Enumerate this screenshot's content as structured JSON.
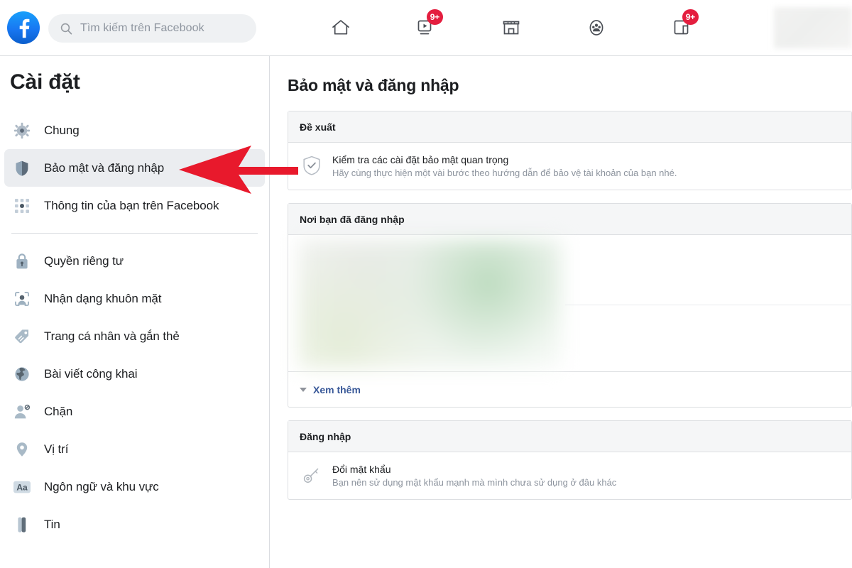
{
  "topbar": {
    "logo_name": "facebook-logo",
    "search": {
      "placeholder": "Tìm kiếm trên Facebook",
      "value": "",
      "icon": "search-icon"
    },
    "nav_items": [
      {
        "name": "home",
        "icon": "home-icon",
        "badge": ""
      },
      {
        "name": "watch",
        "icon": "video-icon",
        "badge": "9+"
      },
      {
        "name": "marketplace",
        "icon": "shop-icon",
        "badge": ""
      },
      {
        "name": "groups",
        "icon": "groups-icon",
        "badge": ""
      },
      {
        "name": "gaming",
        "icon": "gaming-icon",
        "badge": "9+"
      }
    ],
    "profile": {
      "name": "profile-area",
      "label": ""
    }
  },
  "sidebar": {
    "title": "Cài đặt",
    "group_one": [
      {
        "label": "Chung",
        "icon": "gear-icon",
        "active": false
      },
      {
        "label": "Bảo mật và đăng nhập",
        "icon": "shield-icon",
        "active": true
      },
      {
        "label": "Thông tin của bạn trên Facebook",
        "icon": "grid-dots-icon",
        "active": false
      }
    ],
    "group_two": [
      {
        "label": "Quyền riêng tư",
        "icon": "lock-icon",
        "active": false
      },
      {
        "label": "Nhận dạng khuôn mặt",
        "icon": "face-recognition-icon",
        "active": false
      },
      {
        "label": "Trang cá nhân và gắn thẻ",
        "icon": "tag-icon",
        "active": false
      },
      {
        "label": "Bài viết công khai",
        "icon": "globe-icon",
        "active": false
      },
      {
        "label": "Chặn",
        "icon": "block-user-icon",
        "active": false
      },
      {
        "label": "Vị trí",
        "icon": "location-pin-icon",
        "active": false
      },
      {
        "label": "Ngôn ngữ và khu vực",
        "icon": "language-aa-icon",
        "active": false
      },
      {
        "label": "Tin",
        "icon": "stories-icon",
        "active": false
      }
    ]
  },
  "main": {
    "page_title": "Bảo mật và đăng nhập",
    "cards": {
      "suggestions": {
        "header": "Đề xuất",
        "row": {
          "icon": "shield-check-icon",
          "title": "Kiểm tra các cài đặt bảo mật quan trọng",
          "subtitle": "Hãy cùng thực hiện một vài bước theo hướng dẫn để bảo vệ tài khoản của bạn nhé."
        }
      },
      "where_logged_in": {
        "header": "Nơi bạn đã đăng nhập",
        "footer_link": "Xem thêm",
        "footer_caret": "chevron-down-icon"
      },
      "login": {
        "header": "Đăng nhập",
        "row": {
          "icon": "key-icon",
          "title": "Đổi mật khẩu",
          "subtitle": "Bạn nên sử dụng mật khẩu mạnh mà mình chưa sử dụng ở đâu khác"
        }
      }
    }
  },
  "annotation": {
    "name": "red-arrow-pointing-to-security-login",
    "color": "#e8192c"
  },
  "colors": {
    "facebook_blue": "#1877f2",
    "badge_red": "#e41e3f",
    "link_blue": "#385898",
    "text_primary": "#1c1e21",
    "text_secondary": "#8d949e",
    "border": "#dddfe2",
    "card_header_bg": "#f5f6f7",
    "active_item_bg": "#ebedf0",
    "annotation_red": "#e8192c"
  }
}
